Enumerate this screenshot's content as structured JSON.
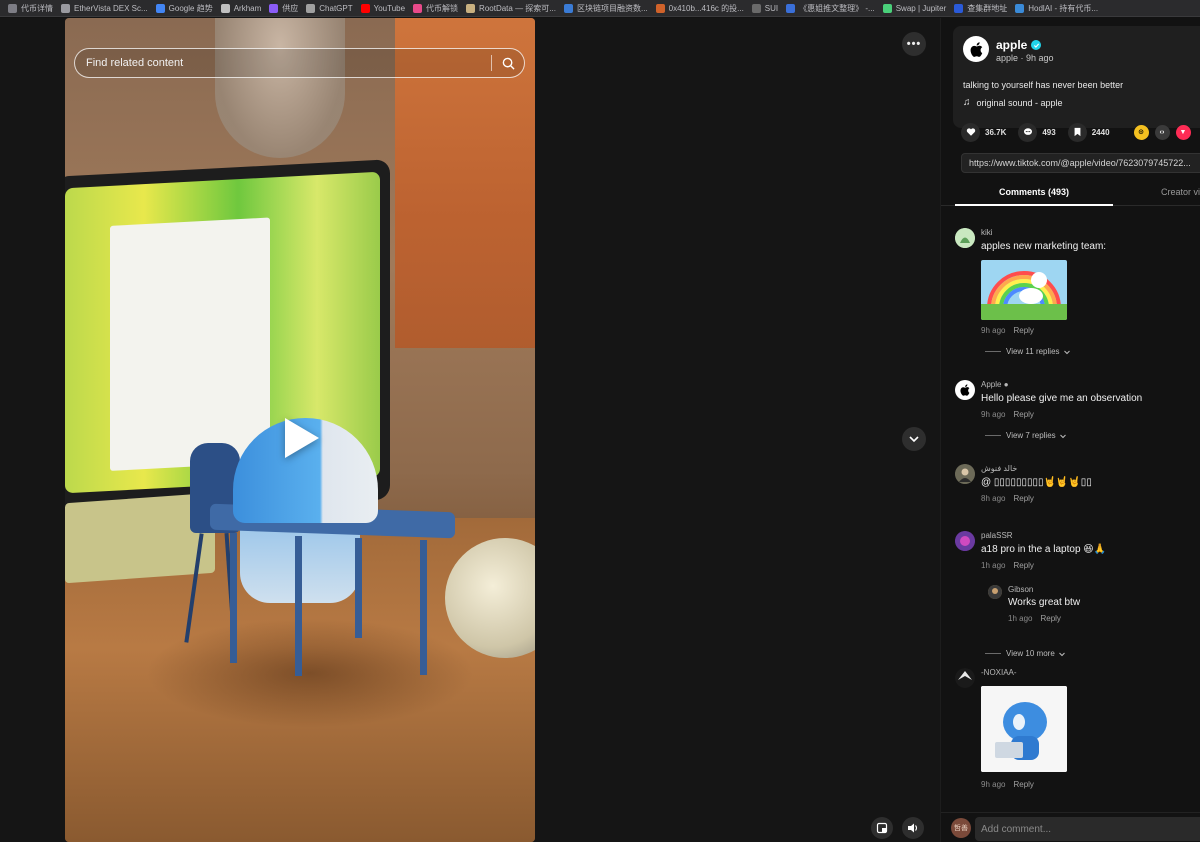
{
  "bookmarks": [
    {
      "label": "代币详情",
      "color": "#7d7d85"
    },
    {
      "label": "EtherVista DEX Sc...",
      "color": "#9a9aa0"
    },
    {
      "label": "Google 趋势",
      "color": "#4285f4"
    },
    {
      "label": "Arkham",
      "color": "#c0c0c0"
    },
    {
      "label": "供应",
      "color": "#8b5cf6"
    },
    {
      "label": "ChatGPT",
      "color": "#a0a0a0"
    },
    {
      "label": "YouTube",
      "color": "#ff0000"
    },
    {
      "label": "代币解锁",
      "color": "#e84a8a"
    },
    {
      "label": "RootData — 探索可...",
      "color": "#c8b080"
    },
    {
      "label": "区块链项目融资数...",
      "color": "#3a7bd5"
    },
    {
      "label": "0x410b...416c 的投...",
      "color": "#d0622a"
    },
    {
      "label": "SUI",
      "color": "#6a6a6a"
    },
    {
      "label": "《惠姐推文整理》 -...",
      "color": "#3a6fd8"
    },
    {
      "label": "Swap | Jupiter",
      "color": "#4ad07a"
    },
    {
      "label": "查集群地址",
      "color": "#2a5ad8"
    },
    {
      "label": "HodlAI - 持有代币...",
      "color": "#3a8ad8"
    }
  ],
  "search": {
    "placeholder": "Find related content"
  },
  "video": {
    "more_label": "•••"
  },
  "author": {
    "name": "apple",
    "handle_time": "apple · 9h ago",
    "caption": "talking to yourself has never been better",
    "sound": "original sound - apple"
  },
  "stats": {
    "likes": "36.7K",
    "comments": "493",
    "saves": "2440"
  },
  "share_colors": {
    "coin": "#f4c020",
    "embed": "#3a3a3a",
    "send": "#fe2c55"
  },
  "url": "https://www.tiktok.com/@apple/video/7623079745722...",
  "tabs": {
    "comments": "Comments (493)",
    "creator": "Creator vi"
  },
  "comments": [
    {
      "user": "kiki",
      "text": "apples new marketing team:",
      "time": "9h ago",
      "reply": "Reply",
      "view": "View 11 replies"
    },
    {
      "user": "Apple ",
      "text": "Hello please give me an observation",
      "time": "9h ago",
      "reply": "Reply",
      "view": "View 7 replies"
    },
    {
      "user": "خالد فنوش",
      "text": "@ ▯▯▯▯▯▯▯▯▯🤘🤘🤘▯▯",
      "time": "8h ago",
      "reply": "Reply"
    },
    {
      "user": "palaSSR",
      "text": "a18 pro in the a laptop 😆🙏",
      "time": "1h ago",
      "reply": "Reply",
      "view": "View 10 more",
      "sub": {
        "user": "Gibson",
        "text": "Works great btw",
        "time": "1h ago",
        "reply": "Reply"
      }
    },
    {
      "user": "-NOXIAA-",
      "time": "9h ago",
      "reply": "Reply"
    }
  ],
  "composer": {
    "placeholder": "Add comment...",
    "avatar_text": "哲善"
  }
}
